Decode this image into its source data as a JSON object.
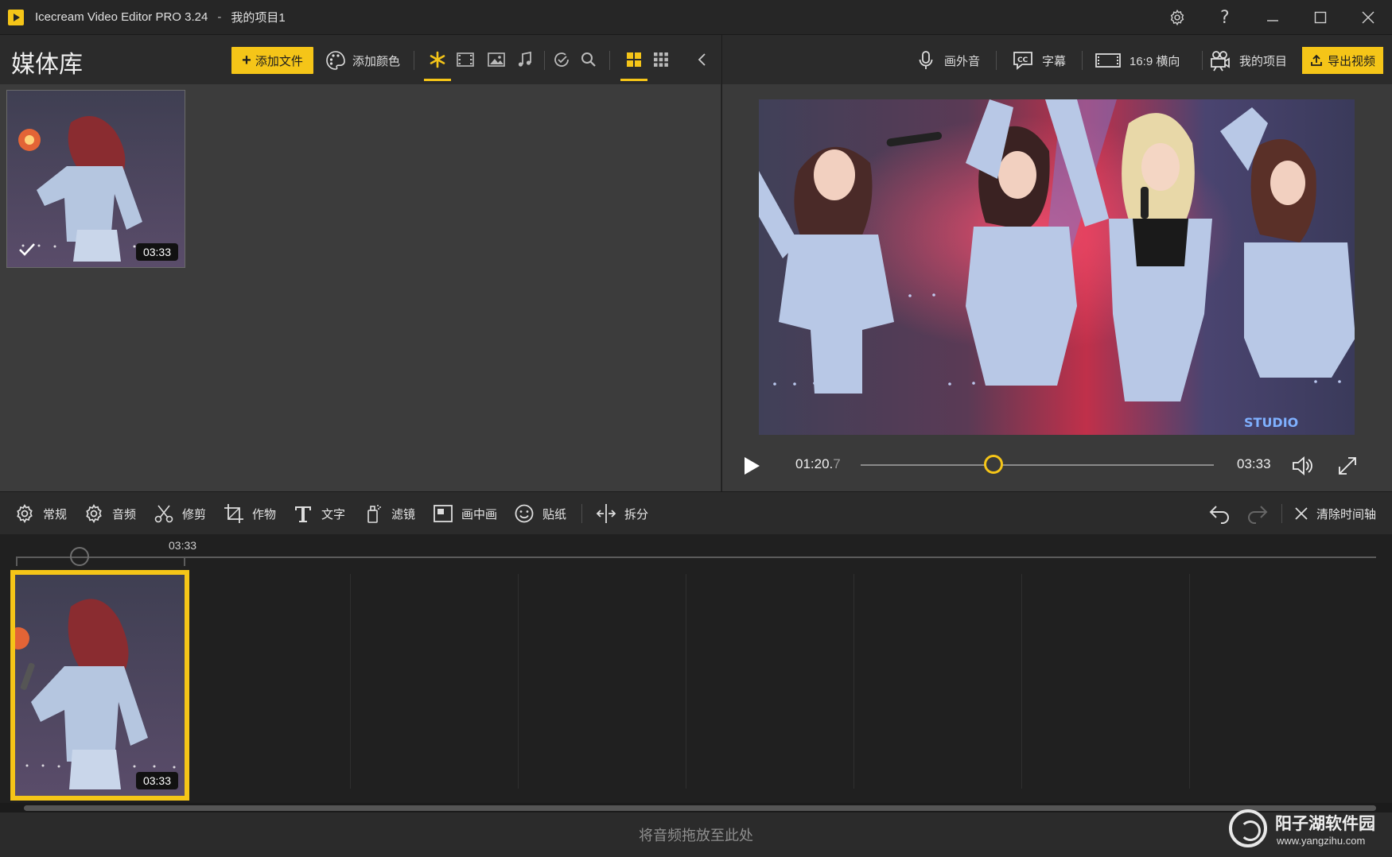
{
  "titlebar": {
    "app_name": "Icecream Video Editor PRO 3.24",
    "separator": "-",
    "project_name": "我的项目1"
  },
  "media_library": {
    "title": "媒体库",
    "add_file_label": "添加文件",
    "add_color_label": "添加颜色",
    "items": [
      {
        "duration": "03:33",
        "selected": true
      }
    ]
  },
  "preview_toolbar": {
    "voiceover_label": "画外音",
    "subtitles_label": "字幕",
    "aspect_label": "16:9 横向",
    "my_projects_label": "我的项目",
    "export_label": "导出视频"
  },
  "player": {
    "current_time_main": "01:20.",
    "current_time_frac": "7",
    "total_time": "03:33",
    "progress": 0.377
  },
  "edit_toolbar": {
    "general": "常规",
    "audio": "音频",
    "trim": "修剪",
    "crop": "作物",
    "text": "文字",
    "filter": "滤镜",
    "pip": "画中画",
    "sticker": "贴纸",
    "split": "拆分",
    "clear_timeline": "清除时间轴"
  },
  "timeline": {
    "ruler_label": "03:33",
    "clip_duration": "03:33"
  },
  "audio_track": {
    "drop_hint": "将音频拖放至此处"
  },
  "watermark": {
    "title": "阳子湖软件园",
    "url": "www.yangzihu.com"
  },
  "colors": {
    "accent": "#f5c518",
    "panel_dark": "#2b2b2b",
    "panel_mid": "#3c3c3c",
    "timeline_bg": "#202020"
  }
}
